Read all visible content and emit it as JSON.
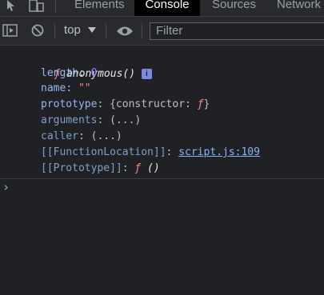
{
  "tabs": [
    {
      "label": "Elements"
    },
    {
      "label": "Console"
    },
    {
      "label": "Sources"
    },
    {
      "label": "Network"
    }
  ],
  "toolbar": {
    "context": "top",
    "filter_placeholder": "Filter"
  },
  "console": {
    "header": {
      "f": "ƒ",
      "name": "anonymous()",
      "info": "i"
    },
    "props": {
      "length": {
        "key": "length",
        "value": "0"
      },
      "name": {
        "key": "name",
        "value": "\"\""
      },
      "prototype": {
        "key": "prototype",
        "value": "{constructor: ",
        "value_f": "ƒ",
        "value_end": "}"
      },
      "arguments": {
        "key": "arguments",
        "value": "(...)"
      },
      "caller": {
        "key": "caller",
        "value": "(...)"
      },
      "function_location": {
        "key": "[[FunctionLocation]]",
        "value": "script.js:109"
      },
      "proto": {
        "key": "[[Prototype]]",
        "value_f": "ƒ",
        "value": " ()"
      }
    },
    "prompt": "›"
  },
  "colors": {
    "accent": "#8ab4f8",
    "own_key": "#9ab4f5",
    "number": "#9980ff",
    "string": "#f28b82"
  }
}
